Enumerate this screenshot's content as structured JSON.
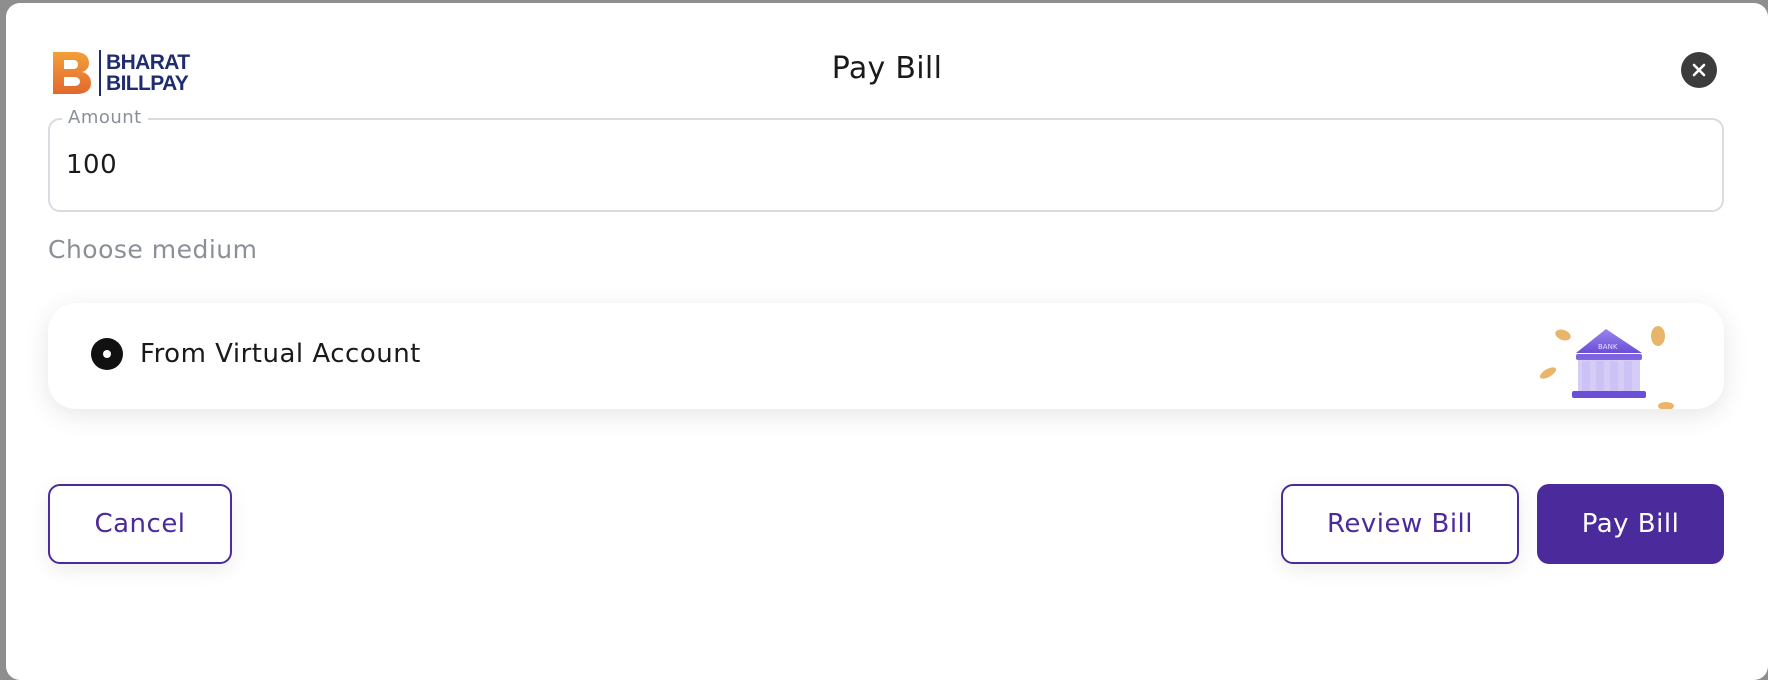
{
  "brand": {
    "line1": "BHARAT",
    "line2": "BILLPAY",
    "primary_color": "#1f2d6e",
    "accent_color": "#e8812f"
  },
  "modal": {
    "title": "Pay Bill",
    "close_icon": "close-icon"
  },
  "amount": {
    "label": "Amount",
    "value": "100"
  },
  "medium": {
    "section_label": "Choose medium",
    "options": [
      {
        "label": "From Virtual Account",
        "selected": true,
        "icon": "bank-icon"
      }
    ]
  },
  "actions": {
    "cancel_label": "Cancel",
    "review_label": "Review Bill",
    "pay_label": "Pay Bill"
  },
  "colors": {
    "primary": "#4b2a9b",
    "text": "#1a1a1a",
    "muted": "#8a8f98",
    "overlay": "#8e8e8e"
  }
}
